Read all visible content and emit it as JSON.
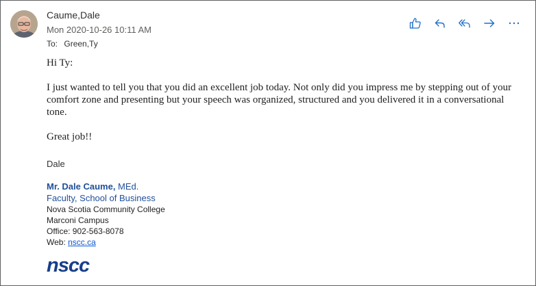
{
  "email": {
    "sender": "Caume,Dale",
    "date": "Mon 2020-10-26 10:11 AM",
    "to_label": "To:",
    "to_value": "Green,Ty",
    "greeting": "Hi Ty:",
    "paragraph": "I just wanted to tell you that you did an excellent job today.  Not only did you impress me by stepping out of your comfort zone and presenting but your speech was organized, structured and you delivered it in a conversational tone.",
    "closing": "Great job!!",
    "signoff": "Dale"
  },
  "actions": {
    "like": "thumbs-up-icon",
    "reply": "reply-icon",
    "reply_all": "reply-all-icon",
    "forward": "forward-icon",
    "more": "more-icon",
    "accent": "#1f6fc7"
  },
  "signature": {
    "name_bold": "Mr. Dale Caume,",
    "name_suffix": " MEd.",
    "faculty": "Faculty, School of Business",
    "college": "Nova Scotia Community College",
    "campus": "Marconi  Campus",
    "office": "Office: 902-563-8078",
    "web_label": "Web: ",
    "web_link": "nscc.ca",
    "logo_text": "nscc",
    "logo_color": "#173f8a"
  }
}
